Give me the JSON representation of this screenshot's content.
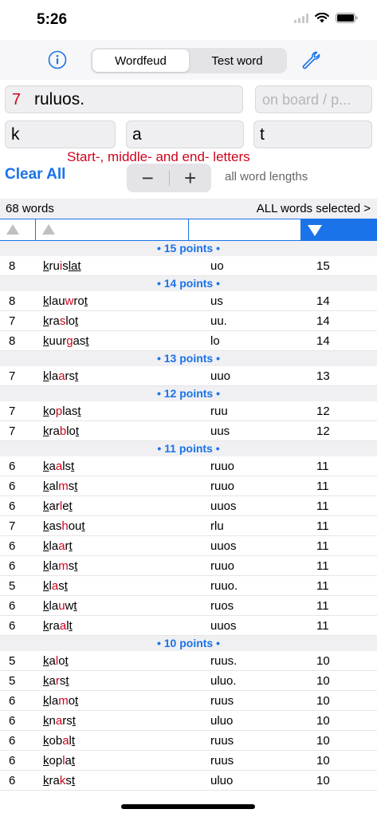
{
  "status": {
    "time": "5:26"
  },
  "toolbar": {
    "segments": [
      "Wordfeud",
      "Test word"
    ],
    "active_segment": 0
  },
  "input": {
    "number": "7",
    "word": "ruluos.",
    "board_placeholder": "on board / p..."
  },
  "letters": {
    "start": "k",
    "middle": "a",
    "end": "t"
  },
  "hint": "Start-, middle- and end- letters",
  "controls": {
    "clear_all": "Clear All",
    "minus": "−",
    "plus": "+",
    "word_lengths": "all word lengths"
  },
  "summary": {
    "count": "68 words",
    "selection": "ALL words selected >"
  },
  "colors": {
    "accent": "#1a73e8",
    "red": "#d0021b"
  },
  "groups": [
    {
      "label": "• 15 points •",
      "rows": [
        {
          "len": "8",
          "word": [
            [
              "k",
              "u"
            ],
            [
              "r",
              ""
            ],
            [
              "u",
              ""
            ],
            [
              "i",
              "r"
            ],
            [
              "s",
              ""
            ],
            [
              "l",
              "u"
            ],
            [
              "a",
              "u"
            ],
            [
              "t",
              "u"
            ]
          ],
          "rack": "uo",
          "pts": "15"
        }
      ]
    },
    {
      "label": "• 14 points •",
      "rows": [
        {
          "len": "8",
          "word": [
            [
              "k",
              "u"
            ],
            [
              "l",
              ""
            ],
            [
              "a",
              ""
            ],
            [
              "u",
              ""
            ],
            [
              "w",
              "r"
            ],
            [
              "r",
              ""
            ],
            [
              "o",
              ""
            ],
            [
              "t",
              "u"
            ]
          ],
          "rack": "us",
          "pts": "14"
        },
        {
          "len": "7",
          "word": [
            [
              "k",
              "u"
            ],
            [
              "r",
              ""
            ],
            [
              "a",
              ""
            ],
            [
              "s",
              "r"
            ],
            [
              "l",
              ""
            ],
            [
              "o",
              ""
            ],
            [
              "t",
              "u"
            ]
          ],
          "rack": "uu.",
          "pts": "14"
        },
        {
          "len": "8",
          "word": [
            [
              "k",
              "u"
            ],
            [
              "u",
              ""
            ],
            [
              "u",
              ""
            ],
            [
              "r",
              ""
            ],
            [
              "g",
              "r"
            ],
            [
              "a",
              ""
            ],
            [
              "s",
              ""
            ],
            [
              "t",
              "u"
            ]
          ],
          "rack": "lo",
          "pts": "14"
        }
      ]
    },
    {
      "label": "• 13 points •",
      "rows": [
        {
          "len": "7",
          "word": [
            [
              "k",
              "u"
            ],
            [
              "l",
              ""
            ],
            [
              "a",
              ""
            ],
            [
              "a",
              "r"
            ],
            [
              "r",
              ""
            ],
            [
              "s",
              ""
            ],
            [
              "t",
              "u"
            ]
          ],
          "rack": "uuo",
          "pts": "13"
        }
      ]
    },
    {
      "label": "• 12 points •",
      "rows": [
        {
          "len": "7",
          "word": [
            [
              "k",
              "u"
            ],
            [
              "o",
              ""
            ],
            [
              "p",
              "r"
            ],
            [
              "l",
              ""
            ],
            [
              "a",
              ""
            ],
            [
              "s",
              ""
            ],
            [
              "t",
              "u"
            ]
          ],
          "rack": "ruu",
          "pts": "12"
        },
        {
          "len": "7",
          "word": [
            [
              "k",
              "u"
            ],
            [
              "r",
              ""
            ],
            [
              "a",
              ""
            ],
            [
              "b",
              "r"
            ],
            [
              "l",
              ""
            ],
            [
              "o",
              ""
            ],
            [
              "t",
              "u"
            ]
          ],
          "rack": "uus",
          "pts": "12"
        }
      ]
    },
    {
      "label": "• 11 points •",
      "rows": [
        {
          "len": "6",
          "word": [
            [
              "k",
              "u"
            ],
            [
              "a",
              ""
            ],
            [
              "a",
              "r"
            ],
            [
              "l",
              ""
            ],
            [
              "s",
              ""
            ],
            [
              "t",
              "u"
            ]
          ],
          "rack": "ruuo",
          "pts": "11"
        },
        {
          "len": "6",
          "word": [
            [
              "k",
              "u"
            ],
            [
              "a",
              ""
            ],
            [
              "l",
              ""
            ],
            [
              "m",
              "r"
            ],
            [
              "s",
              ""
            ],
            [
              "t",
              "u"
            ]
          ],
          "rack": "ruuo",
          "pts": "11"
        },
        {
          "len": "6",
          "word": [
            [
              "k",
              "u"
            ],
            [
              "a",
              ""
            ],
            [
              "r",
              ""
            ],
            [
              "l",
              "r"
            ],
            [
              "e",
              ""
            ],
            [
              "t",
              "u"
            ]
          ],
          "rack": "uuos",
          "pts": "11"
        },
        {
          "len": "7",
          "word": [
            [
              "k",
              "u"
            ],
            [
              "a",
              ""
            ],
            [
              "s",
              ""
            ],
            [
              "h",
              "r"
            ],
            [
              "o",
              ""
            ],
            [
              "u",
              ""
            ],
            [
              "t",
              "u"
            ]
          ],
          "rack": "rlu",
          "pts": "11"
        },
        {
          "len": "6",
          "word": [
            [
              "k",
              "u"
            ],
            [
              "l",
              ""
            ],
            [
              "a",
              ""
            ],
            [
              "a",
              "r"
            ],
            [
              "r",
              ""
            ],
            [
              "t",
              "u"
            ]
          ],
          "rack": "uuos",
          "pts": "11"
        },
        {
          "len": "6",
          "word": [
            [
              "k",
              "u"
            ],
            [
              "l",
              ""
            ],
            [
              "a",
              ""
            ],
            [
              "m",
              "r"
            ],
            [
              "s",
              ""
            ],
            [
              "t",
              "u"
            ]
          ],
          "rack": "ruuo",
          "pts": "11"
        },
        {
          "len": "5",
          "word": [
            [
              "k",
              "u"
            ],
            [
              "l",
              ""
            ],
            [
              "a",
              "r"
            ],
            [
              "s",
              ""
            ],
            [
              "t",
              "u"
            ]
          ],
          "rack": "ruuo.",
          "pts": "11"
        },
        {
          "len": "6",
          "word": [
            [
              "k",
              "u"
            ],
            [
              "l",
              ""
            ],
            [
              "a",
              ""
            ],
            [
              "u",
              "r"
            ],
            [
              "w",
              ""
            ],
            [
              "t",
              "u"
            ]
          ],
          "rack": "ruos",
          "pts": "11"
        },
        {
          "len": "6",
          "word": [
            [
              "k",
              "u"
            ],
            [
              "r",
              ""
            ],
            [
              "a",
              ""
            ],
            [
              "a",
              "r"
            ],
            [
              "l",
              ""
            ],
            [
              "t",
              "u"
            ]
          ],
          "rack": "uuos",
          "pts": "11"
        }
      ]
    },
    {
      "label": "• 10 points •",
      "rows": [
        {
          "len": "5",
          "word": [
            [
              "k",
              "u"
            ],
            [
              "a",
              ""
            ],
            [
              "l",
              "r"
            ],
            [
              "o",
              ""
            ],
            [
              "t",
              "u"
            ]
          ],
          "rack": "ruus.",
          "pts": "10"
        },
        {
          "len": "5",
          "word": [
            [
              "k",
              "u"
            ],
            [
              "a",
              ""
            ],
            [
              "r",
              "r"
            ],
            [
              "s",
              ""
            ],
            [
              "t",
              "u"
            ]
          ],
          "rack": "uluo.",
          "pts": "10"
        },
        {
          "len": "6",
          "word": [
            [
              "k",
              "u"
            ],
            [
              "l",
              ""
            ],
            [
              "a",
              ""
            ],
            [
              "m",
              "r"
            ],
            [
              "o",
              ""
            ],
            [
              "t",
              "u"
            ]
          ],
          "rack": "ruus",
          "pts": "10"
        },
        {
          "len": "6",
          "word": [
            [
              "k",
              "u"
            ],
            [
              "n",
              ""
            ],
            [
              "a",
              "r"
            ],
            [
              "r",
              ""
            ],
            [
              "s",
              ""
            ],
            [
              "t",
              "u"
            ]
          ],
          "rack": "uluo",
          "pts": "10"
        },
        {
          "len": "6",
          "word": [
            [
              "k",
              "u"
            ],
            [
              "o",
              ""
            ],
            [
              "b",
              ""
            ],
            [
              "a",
              "r"
            ],
            [
              "l",
              ""
            ],
            [
              "t",
              "u"
            ]
          ],
          "rack": "ruus",
          "pts": "10"
        },
        {
          "len": "6",
          "word": [
            [
              "k",
              "u"
            ],
            [
              "o",
              ""
            ],
            [
              "p",
              ""
            ],
            [
              "l",
              "r"
            ],
            [
              "a",
              ""
            ],
            [
              "t",
              "u"
            ]
          ],
          "rack": "ruus",
          "pts": "10"
        },
        {
          "len": "6",
          "word": [
            [
              "k",
              "u"
            ],
            [
              "r",
              ""
            ],
            [
              "a",
              ""
            ],
            [
              "k",
              "r"
            ],
            [
              "s",
              ""
            ],
            [
              "t",
              "u"
            ]
          ],
          "rack": "uluo",
          "pts": "10"
        }
      ]
    }
  ]
}
